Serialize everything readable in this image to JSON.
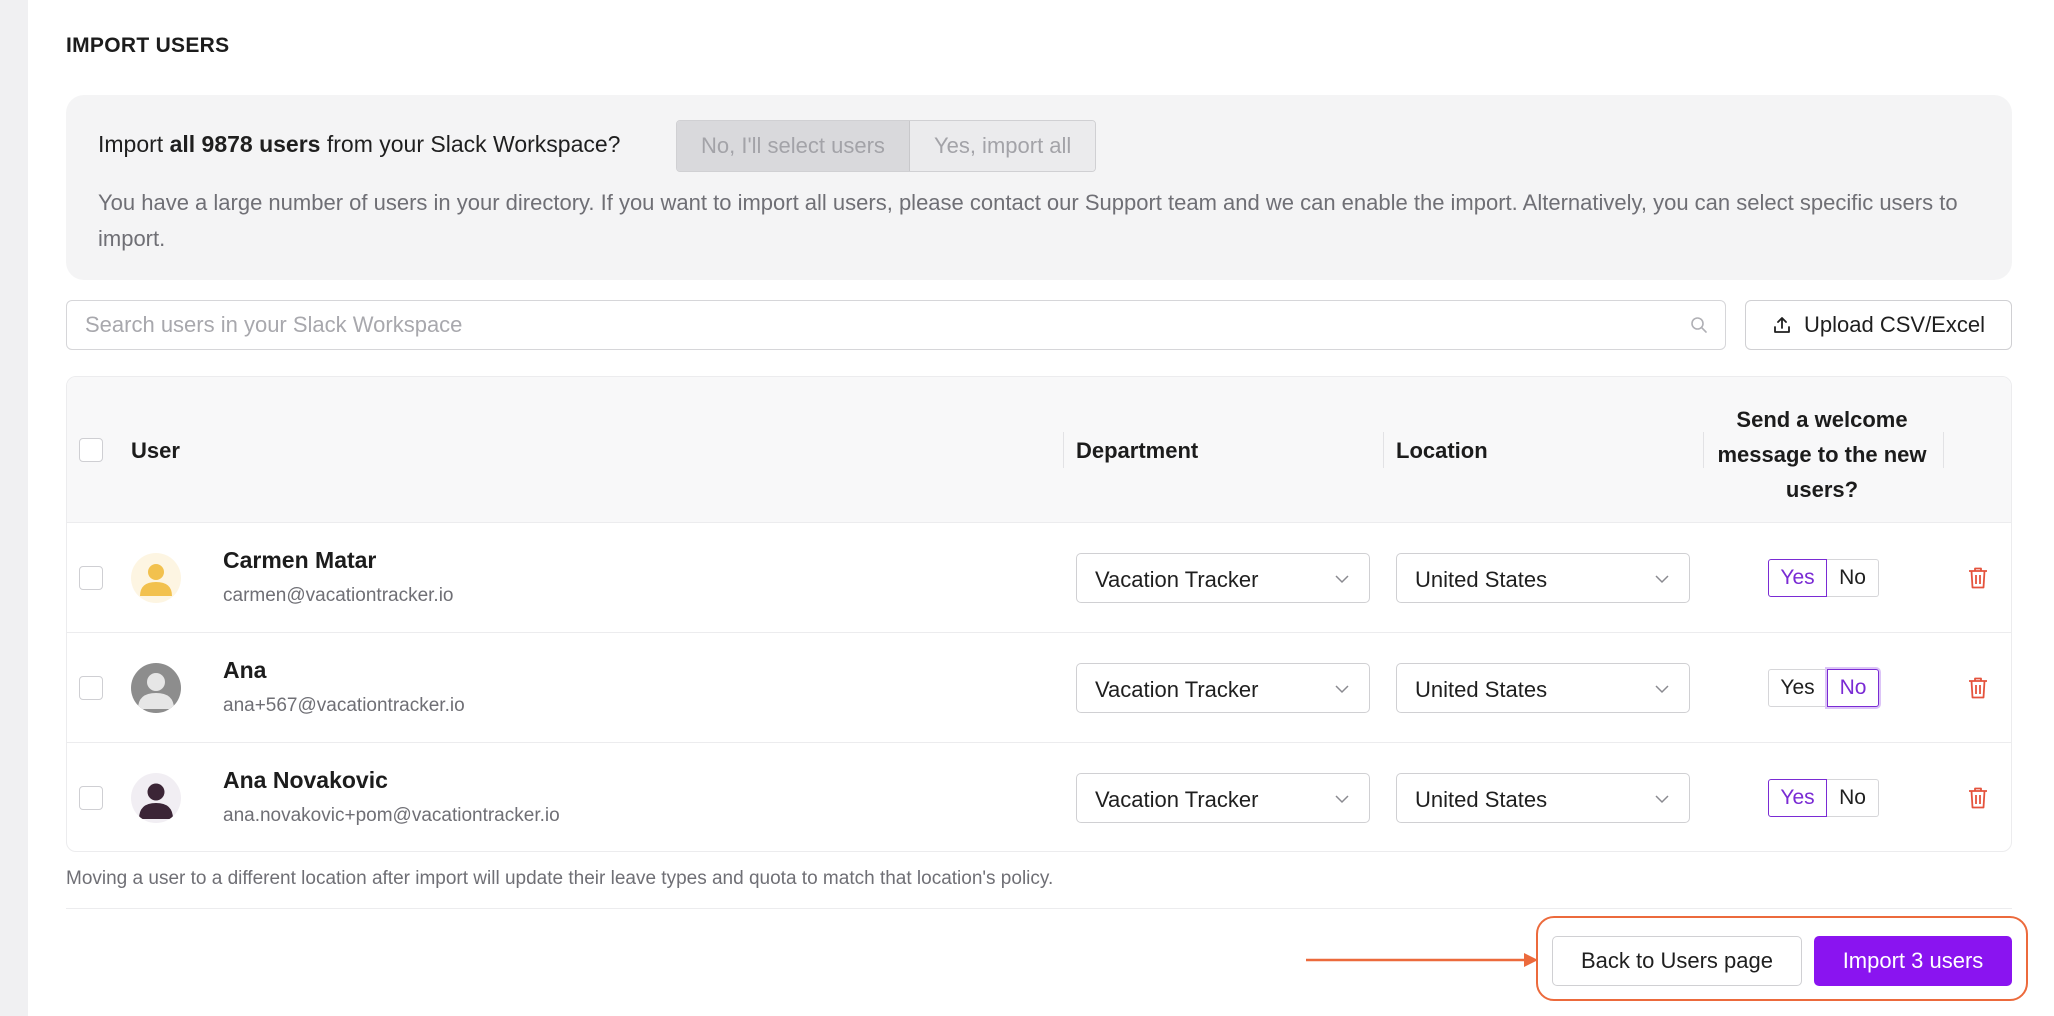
{
  "page": {
    "title": "IMPORT USERS"
  },
  "banner": {
    "question_prefix": "Import ",
    "question_bold": "all 9878 users",
    "question_suffix": " from your Slack Workspace?",
    "option_no": "No, I'll select users",
    "option_yes": "Yes, import all",
    "description": "You have a large number of users in your directory. If you want to import all users, please contact our Support team and we can enable the import. Alternatively, you can select specific users to import."
  },
  "search": {
    "placeholder": "Search users in your Slack Workspace",
    "icon": "search-icon"
  },
  "upload": {
    "label": "Upload CSV/Excel",
    "icon": "upload-icon"
  },
  "table": {
    "headers": {
      "user": "User",
      "department": "Department",
      "location": "Location",
      "welcome": "Send a welcome message to the new users?"
    },
    "rows": [
      {
        "name": "Carmen Matar",
        "email": "carmen@vacationtracker.io",
        "department": "Vacation Tracker",
        "location": "United States",
        "yes": "Yes",
        "no": "No",
        "welcome": "yes"
      },
      {
        "name": "Ana",
        "email": "ana+567@vacationtracker.io",
        "department": "Vacation Tracker",
        "location": "United States",
        "yes": "Yes",
        "no": "No",
        "welcome": "no"
      },
      {
        "name": "Ana Novakovic",
        "email": "ana.novakovic+pom@vacationtracker.io",
        "department": "Vacation Tracker",
        "location": "United States",
        "yes": "Yes",
        "no": "No",
        "welcome": "yes"
      }
    ]
  },
  "note": "Moving a user to a different location after import will update their leave types and quota to match that location's policy.",
  "footer": {
    "back_label": "Back to Users page",
    "import_label": "Import 3 users"
  },
  "colors": {
    "accent": "#8a14f0",
    "highlight": "#ec6a3c",
    "delete": "#e5533d"
  }
}
